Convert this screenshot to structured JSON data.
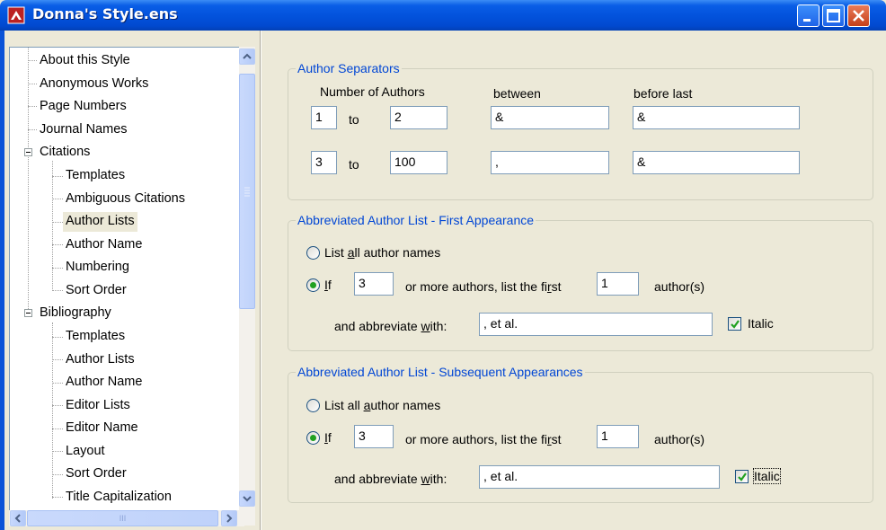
{
  "window": {
    "title": "Donna's Style.ens",
    "icon": "endnote-style-icon"
  },
  "tree": {
    "items": [
      {
        "label": "About this Style",
        "level": 0
      },
      {
        "label": "Anonymous Works",
        "level": 0
      },
      {
        "label": "Page Numbers",
        "level": 0
      },
      {
        "label": "Journal Names",
        "level": 0
      },
      {
        "label": "Citations",
        "level": 0,
        "expanded": true
      },
      {
        "label": "Templates",
        "level": 1
      },
      {
        "label": "Ambiguous Citations",
        "level": 1
      },
      {
        "label": "Author Lists",
        "level": 1,
        "selected": true
      },
      {
        "label": "Author Name",
        "level": 1
      },
      {
        "label": "Numbering",
        "level": 1
      },
      {
        "label": "Sort Order",
        "level": 1
      },
      {
        "label": "Bibliography",
        "level": 0,
        "expanded": true
      },
      {
        "label": "Templates",
        "level": 1
      },
      {
        "label": "Author Lists",
        "level": 1
      },
      {
        "label": "Author Name",
        "level": 1
      },
      {
        "label": "Editor Lists",
        "level": 1
      },
      {
        "label": "Editor Name",
        "level": 1
      },
      {
        "label": "Layout",
        "level": 1
      },
      {
        "label": "Sort Order",
        "level": 1
      },
      {
        "label": "Title Capitalization",
        "level": 1
      }
    ],
    "hscroll_glyph": "III"
  },
  "separators": {
    "title": "Author Separators",
    "col_number": "Number of Authors",
    "col_between": "between",
    "col_before_last": "before last",
    "to_label": "to",
    "rows": [
      {
        "from": "1",
        "to": "2",
        "between": "&",
        "before_last": "&"
      },
      {
        "from": "3",
        "to": "100",
        "between": ",",
        "before_last": "&"
      }
    ]
  },
  "first": {
    "title": "Abbreviated Author List - First Appearance",
    "list_all_pre": "List ",
    "list_all_key": "a",
    "list_all_post": "ll author names",
    "if_key": "I",
    "if_post": "f",
    "if_count": "3",
    "middle_pre": "or more authors, list the fi",
    "middle_key": "r",
    "middle_post": "st",
    "list_first": "1",
    "authors_suffix": "author(s)",
    "abbrev_pre": "and abbreviate ",
    "abbrev_key": "w",
    "abbrev_post": "ith:",
    "abbrev_value": ", et al.",
    "italic_label": "Italic",
    "italic_checked": true,
    "selected_option": "if"
  },
  "subsequent": {
    "title": "Abbreviated Author List - Subsequent Appearances",
    "list_all_pre": "List all ",
    "list_all_key": "a",
    "list_all_post": "uthor names",
    "if_key": "I",
    "if_post": "f",
    "if_count": "3",
    "middle_pre": "or more authors, list the fi",
    "middle_key": "r",
    "middle_post": "st",
    "list_first": "1",
    "authors_suffix": "author(s)",
    "abbrev_pre": "and abbreviate ",
    "abbrev_key": "w",
    "abbrev_post": "ith:",
    "abbrev_value": ", et al.",
    "italic_label": "Italic",
    "italic_checked": true,
    "selected_option": "if"
  }
}
